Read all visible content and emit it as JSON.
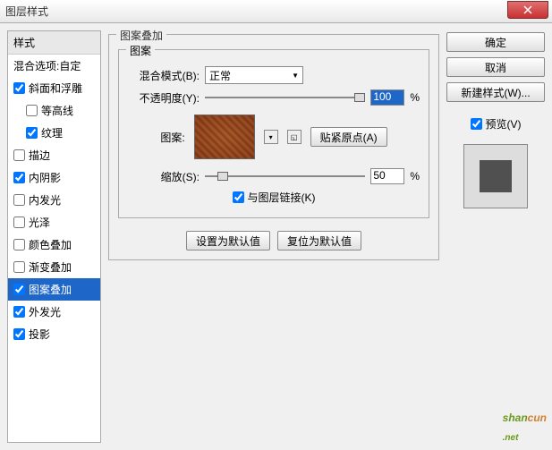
{
  "title": "图层样式",
  "left": {
    "header": "样式",
    "blend_opts": "混合选项:自定",
    "items": [
      {
        "label": "斜面和浮雕",
        "checked": true
      },
      {
        "label": "等高线",
        "checked": false,
        "sub": true
      },
      {
        "label": "纹理",
        "checked": true,
        "sub": true
      },
      {
        "label": "描边",
        "checked": false
      },
      {
        "label": "内阴影",
        "checked": true
      },
      {
        "label": "内发光",
        "checked": false
      },
      {
        "label": "光泽",
        "checked": false
      },
      {
        "label": "颜色叠加",
        "checked": false
      },
      {
        "label": "渐变叠加",
        "checked": false
      },
      {
        "label": "图案叠加",
        "checked": true,
        "selected": true
      },
      {
        "label": "外发光",
        "checked": true
      },
      {
        "label": "投影",
        "checked": true
      }
    ]
  },
  "center": {
    "group_title": "图案叠加",
    "pattern_title": "图案",
    "blend_mode_label": "混合模式(B):",
    "blend_mode_value": "正常",
    "opacity_label": "不透明度(Y):",
    "opacity_value": "100",
    "percent": "%",
    "pattern_label": "图案:",
    "snap_btn": "贴紧原点(A)",
    "scale_label": "缩放(S):",
    "scale_value": "50",
    "link_label": "与图层链接(K)",
    "set_default": "设置为默认值",
    "reset_default": "复位为默认值"
  },
  "right": {
    "ok": "确定",
    "cancel": "取消",
    "new_style": "新建样式(W)...",
    "preview": "预览(V)"
  },
  "watermark": {
    "a": "shan",
    "b": "cun",
    "c": ".net"
  }
}
